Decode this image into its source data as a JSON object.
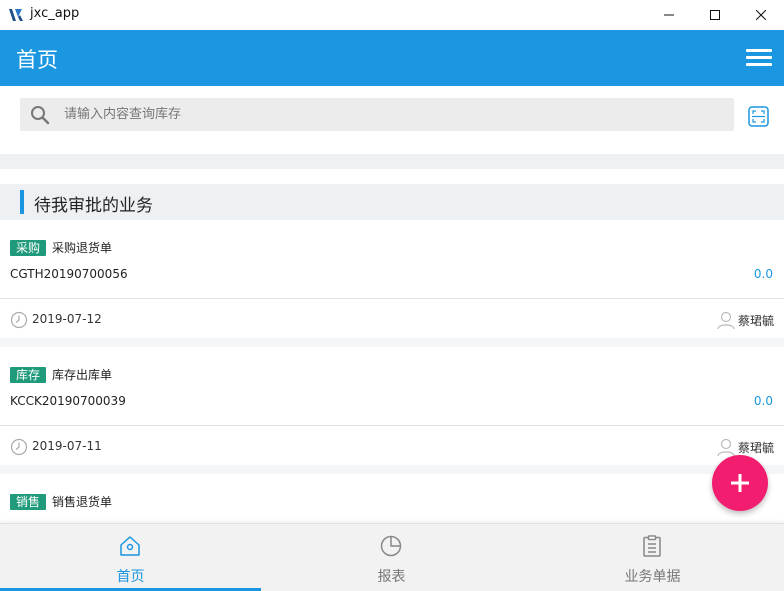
{
  "window": {
    "title": "jxc_app"
  },
  "header": {
    "title": "首页"
  },
  "search": {
    "placeholder": "请输入内容查询库存"
  },
  "section": {
    "title": "待我审批的业务"
  },
  "cards": [
    {
      "tag": "采购",
      "doc_type": "采购退货单",
      "doc_no": "CGTH20190700056",
      "amount": "0.0",
      "date": "2019-07-12",
      "user": "蔡珺毓"
    },
    {
      "tag": "库存",
      "doc_type": "库存出库单",
      "doc_no": "KCCK20190700039",
      "amount": "0.0",
      "date": "2019-07-11",
      "user": "蔡珺毓"
    },
    {
      "tag": "销售",
      "doc_type": "销售退货单"
    }
  ],
  "bottom_nav": [
    {
      "label": "首页",
      "icon": "home-icon",
      "active": true
    },
    {
      "label": "报表",
      "icon": "pie-chart-icon",
      "active": false
    },
    {
      "label": "业务单据",
      "icon": "clipboard-icon",
      "active": false
    }
  ],
  "colors": {
    "primary": "#1b96e0",
    "tag": "#1f9a7a",
    "fab": "#f21d6e"
  }
}
